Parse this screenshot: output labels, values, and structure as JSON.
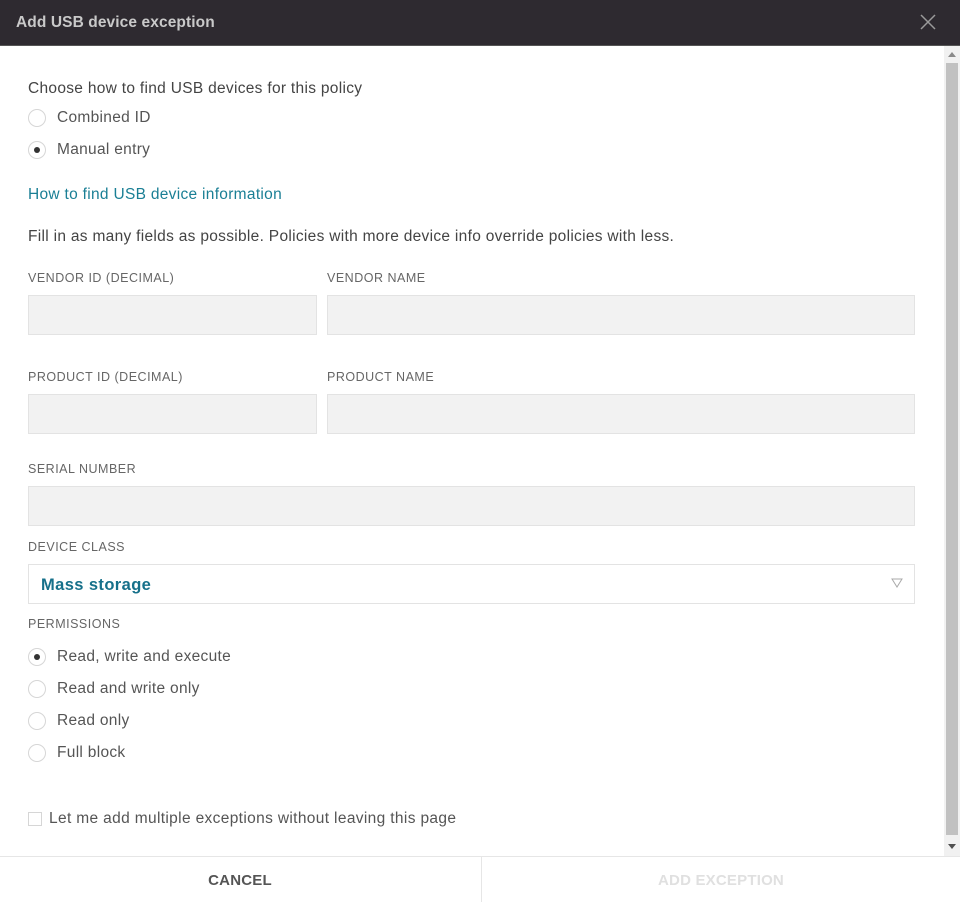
{
  "dialog": {
    "title": "Add USB device exception",
    "close_icon": "close-icon"
  },
  "find_method": {
    "prompt": "Choose how to find USB devices for this policy",
    "options": [
      {
        "label": "Combined ID",
        "checked": false
      },
      {
        "label": "Manual entry",
        "checked": true
      }
    ]
  },
  "help_link": "How to find USB device information",
  "instructions": "Fill in as many fields as possible. Policies with more device info override policies with less.",
  "fields": {
    "vendor_id": {
      "label": "VENDOR ID (DECIMAL)",
      "value": ""
    },
    "vendor_name": {
      "label": "VENDOR NAME",
      "value": ""
    },
    "product_id": {
      "label": "PRODUCT ID (DECIMAL)",
      "value": ""
    },
    "product_name": {
      "label": "PRODUCT NAME",
      "value": ""
    },
    "serial_number": {
      "label": "SERIAL NUMBER",
      "value": ""
    }
  },
  "device_class": {
    "label": "DEVICE CLASS",
    "selected": "Mass storage",
    "caret_icon": "chevron-down-icon"
  },
  "permissions": {
    "label": "PERMISSIONS",
    "options": [
      {
        "label": "Read, write and execute",
        "checked": true
      },
      {
        "label": "Read and write only",
        "checked": false
      },
      {
        "label": "Read only",
        "checked": false
      },
      {
        "label": "Full block",
        "checked": false
      }
    ]
  },
  "multiple_exceptions": {
    "label": "Let me add multiple exceptions without leaving this page",
    "checked": false
  },
  "footer": {
    "cancel_label": "CANCEL",
    "add_label": "ADD EXCEPTION",
    "add_enabled": false
  },
  "colors": {
    "titlebar": "#2e2a30",
    "link": "#1a7f95",
    "select_value": "#16708a",
    "disabled_text": "#e0e0e0"
  }
}
